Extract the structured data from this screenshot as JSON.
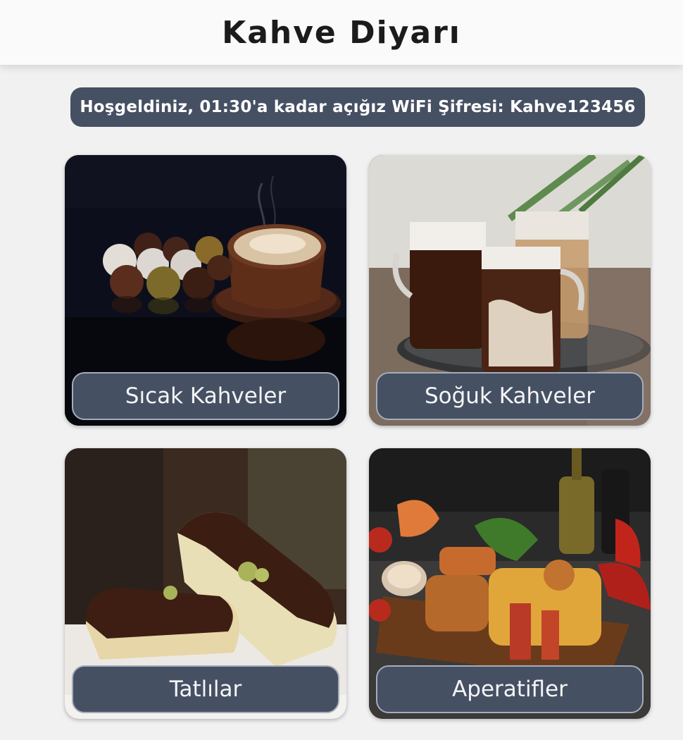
{
  "header": {
    "title": "Kahve Diyarı"
  },
  "banner": {
    "text": "Hoşgeldiniz, 01:30'a kadar açığız WiFi Şifresi: Kahve123456"
  },
  "categories": [
    {
      "label": "Sıcak Kahveler",
      "image": "hot-coffee-with-truffles-photo"
    },
    {
      "label": "Soğuk Kahveler",
      "image": "iced-coffee-glasses-photo"
    },
    {
      "label": "Tatlılar",
      "image": "chocolate-eclairs-photo"
    },
    {
      "label": "Aperatifler",
      "image": "snack-platter-photo"
    }
  ],
  "colors": {
    "button": "#465063",
    "background": "#f1f1f2",
    "header": "#fafafa"
  }
}
